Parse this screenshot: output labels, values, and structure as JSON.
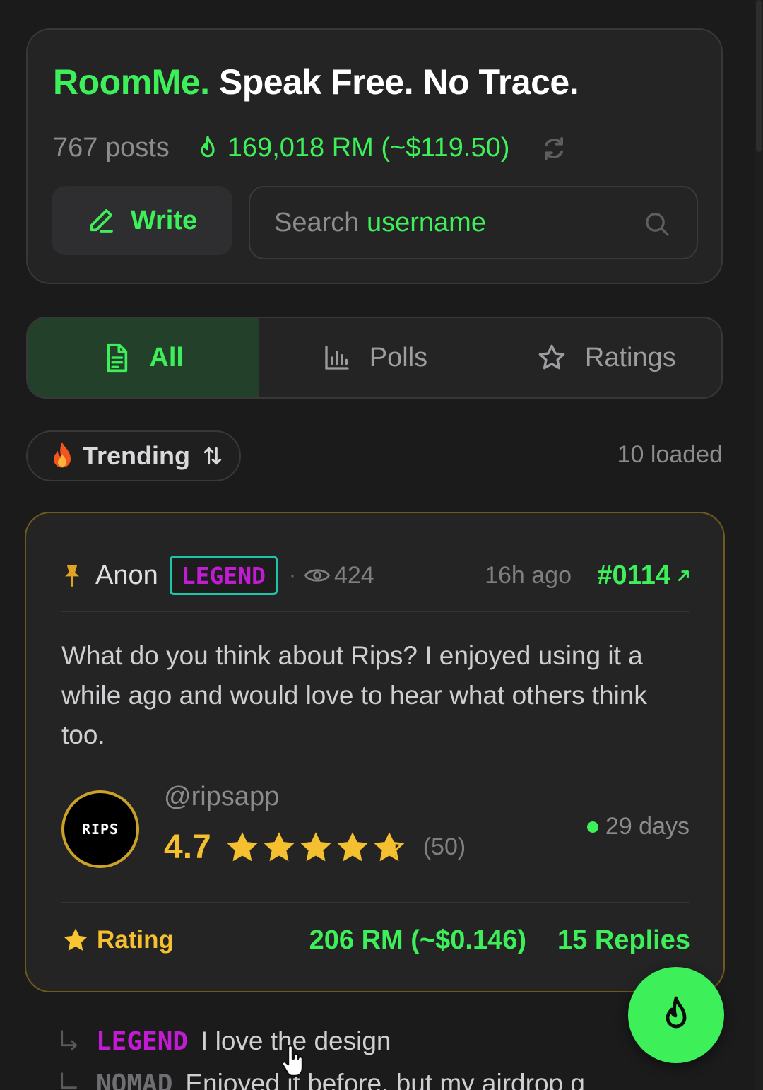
{
  "header": {
    "brand": "RoomMe.",
    "tagline": "Speak Free. No Trace.",
    "posts_count": "767 posts",
    "balance": "169,018 RM (~$119.50)",
    "write_label": "Write",
    "search": {
      "placeholder_prefix": "Search ",
      "placeholder_highlight": "username"
    }
  },
  "tabs": [
    {
      "label": "All",
      "icon": "document-icon",
      "active": true
    },
    {
      "label": "Polls",
      "icon": "bar-chart-icon",
      "active": false
    },
    {
      "label": "Ratings",
      "icon": "star-outline-icon",
      "active": false
    }
  ],
  "sort": {
    "label": "Trending",
    "loaded": "10 loaded"
  },
  "post": {
    "author": "Anon",
    "badge": "LEGEND",
    "views": "424",
    "time": "16h ago",
    "id": "#0114",
    "body": "What do you think about Rips? I enjoyed using it a while ago and would love to hear what others think too.",
    "app": {
      "logo_text": "RIPS",
      "handle": "@ripsapp",
      "rating": "4.7",
      "stars": 4.7,
      "rating_count": "(50)",
      "activity": "29 days"
    },
    "type_label": "Rating",
    "reward": "206 RM (~$0.146)",
    "replies": "15 Replies"
  },
  "reply_previews": [
    {
      "badge": "LEGEND",
      "badge_color": "#c21bd3",
      "text": "I love the design"
    },
    {
      "badge": "NOMAD",
      "badge_color": "#6f6f73",
      "text": "Enjoyed it before, but my airdrop g"
    }
  ],
  "colors": {
    "accent": "#3df05a",
    "gold": "#f5c02f",
    "legend": "#c21bd3",
    "legend_border": "#1fc6a6"
  }
}
